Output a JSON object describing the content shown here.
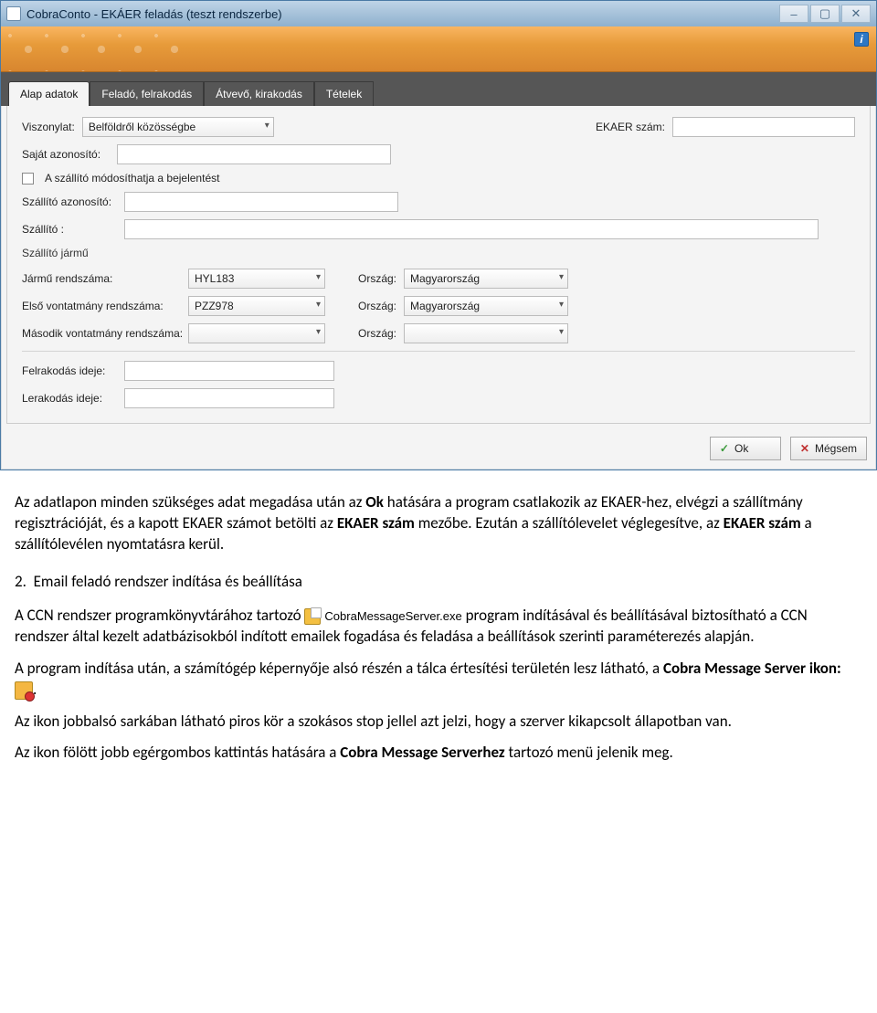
{
  "window": {
    "title": "CobraConto - EKÁER feladás (teszt rendszerbe)",
    "minimize": "–",
    "maximize": "▢",
    "close": "✕"
  },
  "ribbon": {
    "info": "i"
  },
  "tabs": [
    {
      "label": "Alap adatok",
      "active": true
    },
    {
      "label": "Feladó, felrakodás",
      "active": false
    },
    {
      "label": "Átvevő, kirakodás",
      "active": false
    },
    {
      "label": "Tételek",
      "active": false
    }
  ],
  "form": {
    "viszonylat_lbl": "Viszonylat:",
    "viszonylat_val": "Belföldről közösségbe",
    "ekaer_lbl": "EKAER szám:",
    "ekaer_val": "",
    "sajat_az_lbl": "Saját azonosító:",
    "sajat_az_val": "",
    "checkbox_lbl": "A szállító módosíthatja a bejelentést",
    "szall_az_lbl": "Szállító azonosító:",
    "szall_az_val": "",
    "szallito_lbl": "Szállító :",
    "szallito_val": "",
    "jarmu_group": "Szállító jármű",
    "jarmu_rsz_lbl": "Jármű rendszáma:",
    "jarmu_rsz_val": "HYL183",
    "orszag_lbl": "Ország:",
    "orszag1_val": "Magyarország",
    "vont1_lbl": "Első vontatmány rendszáma:",
    "vont1_val": "PZZ978",
    "orszag2_val": "Magyarország",
    "vont2_lbl": "Második vontatmány rendszáma:",
    "vont2_val": "",
    "orszag3_val": "",
    "felrak_lbl": "Felrakodás ideje:",
    "felrak_val": "",
    "lerak_lbl": "Lerakodás ideje:",
    "lerak_val": ""
  },
  "buttons": {
    "ok": "Ok",
    "cancel": "Mégsem"
  },
  "doc": {
    "p1a": "Az adatlapon minden szükséges adat megadása után az ",
    "p1_ok": "Ok",
    "p1b": " hatására a program csatlakozik az EKAER-hez, elvégzi a szállítmány regisztrációját, és a kapott EKAER számot betölti az ",
    "p1_field": "EKAER szám",
    "p1c": " mezőbe. Ezután a szállítólevelet véglegesítve, az ",
    "p1_field2": "EKAER szám",
    "p1d": " a szállítólevélen nyomtatásra kerül.",
    "h2": "Email feladó rendszer indítása és beállítása",
    "h2_num": "2.",
    "p2a": "A CCN rendszer programkönyvtárához tartozó ",
    "exe": "CobraMessageServer.exe",
    "p2b": " program indításával és beállításával biztosítható a CCN rendszer által kezelt adatbázisokból indított emailek fogadása és feladása a beállítások szerinti paraméterezés alapján.",
    "p3a": "A program indítása után, a számítógép képernyője alsó részén a tálca értesítési területén lesz látható, a ",
    "p3_bold": "Cobra Message Server ikon: ",
    "p3b": ".",
    "p4": "Az ikon jobbalsó sarkában látható piros kör a szokásos stop jellel azt jelzi, hogy a szerver kikapcsolt állapotban van.",
    "p5a": "Az ikon fölött jobb egérgombos kattintás hatására a ",
    "p5_bold": "Cobra Message Serverhez",
    "p5b": " tartozó menü jelenik meg."
  }
}
